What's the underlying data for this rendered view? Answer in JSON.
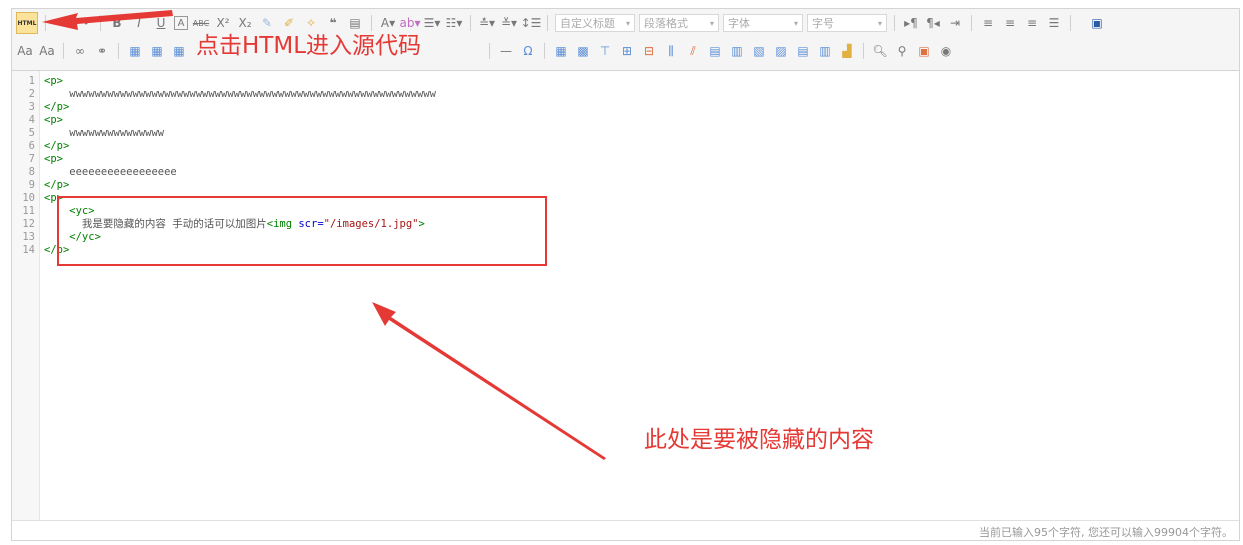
{
  "toolbar": {
    "html_button": "HTML",
    "row1_icons": [
      "undo-icon",
      "redo-icon",
      "bold-icon",
      "italic-icon",
      "underline-icon",
      "font-border-icon",
      "strikethrough-icon",
      "superscript-icon",
      "subscript-icon",
      "eraser-icon",
      "format-brush-icon",
      "auto-format-icon",
      "quote-icon",
      "paste-plain-icon"
    ],
    "row1_icons_b": [
      "font-color-icon",
      "highlight-icon",
      "ordered-list-icon",
      "unordered-list-icon",
      "paragraph-spacing-top-icon",
      "paragraph-spacing-bottom-icon",
      "line-height-icon"
    ],
    "combos": [
      {
        "label": "自定义标题"
      },
      {
        "label": "段落格式"
      },
      {
        "label": "字体"
      },
      {
        "label": "字号"
      }
    ],
    "row1_icons_c": [
      "ltr-icon",
      "rtl-icon",
      "indent-icon",
      "align-left-icon",
      "align-center-icon",
      "align-right-icon",
      "align-justify-icon",
      "fullscreen-icon"
    ]
  },
  "annotations": {
    "top_text": "点击HTML进入源代码",
    "bottom_text": "此处是要被隐藏的内容"
  },
  "code_lines": [
    {
      "n": "1",
      "parts": [
        {
          "t": "tag",
          "v": "<p>"
        }
      ]
    },
    {
      "n": "2",
      "parts": [
        {
          "t": "txt",
          "v": "    wwwwwwwwwwwwwwwwwwwwwwwwwwwwwwwwwwwwwwwwwwwwwwwwwwwwwwwwww"
        }
      ]
    },
    {
      "n": "3",
      "parts": [
        {
          "t": "tag",
          "v": "</p>"
        }
      ]
    },
    {
      "n": "4",
      "parts": [
        {
          "t": "tag",
          "v": "<p>"
        }
      ]
    },
    {
      "n": "5",
      "parts": [
        {
          "t": "txt",
          "v": "    wwwwwwwwwwwwwww"
        }
      ]
    },
    {
      "n": "6",
      "parts": [
        {
          "t": "tag",
          "v": "</p>"
        }
      ]
    },
    {
      "n": "7",
      "parts": [
        {
          "t": "tag",
          "v": "<p>"
        }
      ]
    },
    {
      "n": "8",
      "parts": [
        {
          "t": "txt",
          "v": "    eeeeeeeeeeeeeeeee"
        }
      ]
    },
    {
      "n": "9",
      "parts": [
        {
          "t": "tag",
          "v": "</p>"
        }
      ]
    },
    {
      "n": "10",
      "parts": [
        {
          "t": "tag",
          "v": "<p>"
        }
      ]
    },
    {
      "n": "11",
      "parts": [
        {
          "t": "tag",
          "v": "    <yc>"
        }
      ]
    },
    {
      "n": "12",
      "parts": [
        {
          "t": "txt",
          "v": "      我是要隐藏的内容 手动的话可以加图片"
        },
        {
          "t": "tag",
          "v": "<img "
        },
        {
          "t": "attr",
          "v": "scr="
        },
        {
          "t": "str",
          "v": "\"/images/1.jpg\""
        },
        {
          "t": "tag",
          "v": ">"
        }
      ]
    },
    {
      "n": "13",
      "parts": [
        {
          "t": "tag",
          "v": "    </yc>"
        }
      ]
    },
    {
      "n": "14",
      "parts": [
        {
          "t": "tag",
          "v": "</p>"
        }
      ]
    }
  ],
  "status": {
    "text": "当前已输入95个字符, 您还可以输入99904个字符。"
  }
}
